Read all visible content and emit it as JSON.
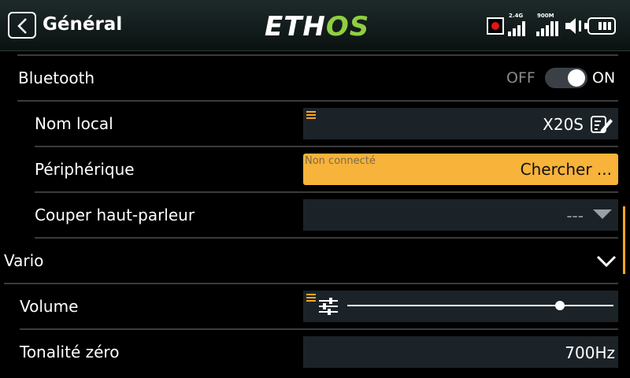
{
  "header": {
    "title": "Général",
    "logo_part1": "ETH",
    "logo_part2": "OS",
    "signal_24": "2.4G",
    "signal_900": "900M",
    "icons": [
      "back-icon",
      "record-icon",
      "signal-bars-icon",
      "speaker-icon",
      "battery-icon"
    ]
  },
  "rows": {
    "bluetooth": {
      "label": "Bluetooth",
      "off": "OFF",
      "on": "ON",
      "state": true
    },
    "local_name": {
      "label": "Nom local",
      "value": "X20S"
    },
    "device": {
      "label": "Périphérique",
      "hint": "Non connecté",
      "button": "Chercher ..."
    },
    "mute": {
      "label": "Couper haut-parleur",
      "value": "---"
    },
    "vario": {
      "label": "Vario"
    },
    "volume": {
      "label": "Volume",
      "level": 0.8
    },
    "zero_tone": {
      "label": "Tonalité zéro",
      "value": "700Hz"
    }
  },
  "colors": {
    "accent": "#f5a623",
    "logo_green": "#8fcf3f",
    "field_bg": "#1c2328"
  }
}
